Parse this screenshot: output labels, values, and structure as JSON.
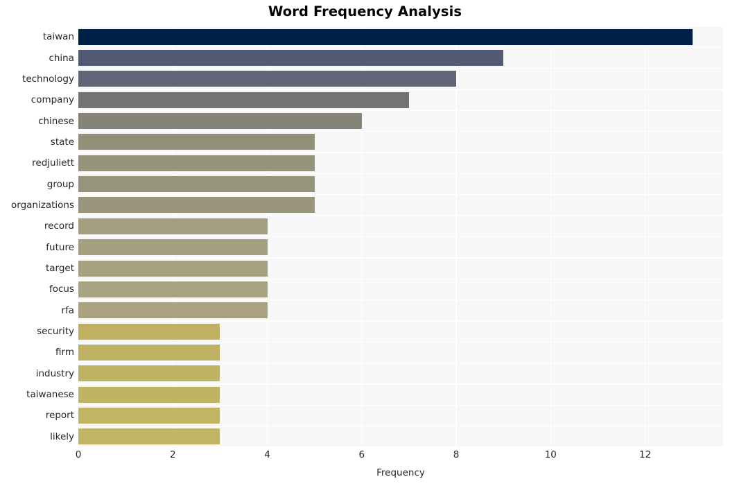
{
  "chart_data": {
    "type": "bar",
    "orientation": "horizontal",
    "title": "Word Frequency Analysis",
    "xlabel": "Frequency",
    "ylabel": "",
    "xlim": [
      0,
      13.65
    ],
    "xticks": [
      0,
      2,
      4,
      6,
      8,
      10,
      12
    ],
    "xtick_labels": [
      "0",
      "2",
      "4",
      "6",
      "8",
      "10",
      "12"
    ],
    "grid": true,
    "legend": false,
    "categories": [
      "taiwan",
      "china",
      "technology",
      "company",
      "chinese",
      "state",
      "redjuliett",
      "group",
      "organizations",
      "record",
      "future",
      "target",
      "focus",
      "rfa",
      "security",
      "firm",
      "industry",
      "taiwanese",
      "report",
      "likely"
    ],
    "values": [
      13,
      9,
      8,
      7,
      6,
      5,
      5,
      5,
      5,
      4,
      4,
      4,
      4,
      4,
      3,
      3,
      3,
      3,
      3,
      3
    ],
    "bar_colors": [
      "#002147",
      "#525a74",
      "#626478",
      "#737373",
      "#868379",
      "#93907a",
      "#96937b",
      "#97947c",
      "#99967d",
      "#a39e7e",
      "#a49f7e",
      "#a5a07e",
      "#a7a280",
      "#a9a381",
      "#bfb161",
      "#bfb162",
      "#c0b263",
      "#c1b364",
      "#c2b465",
      "#c2b466"
    ],
    "panel_background": "#f7f7f7",
    "grid_color": "#ffffff",
    "figure_background": "#ffffff",
    "title_color": "#000000",
    "tick_label_color": "#262626"
  }
}
